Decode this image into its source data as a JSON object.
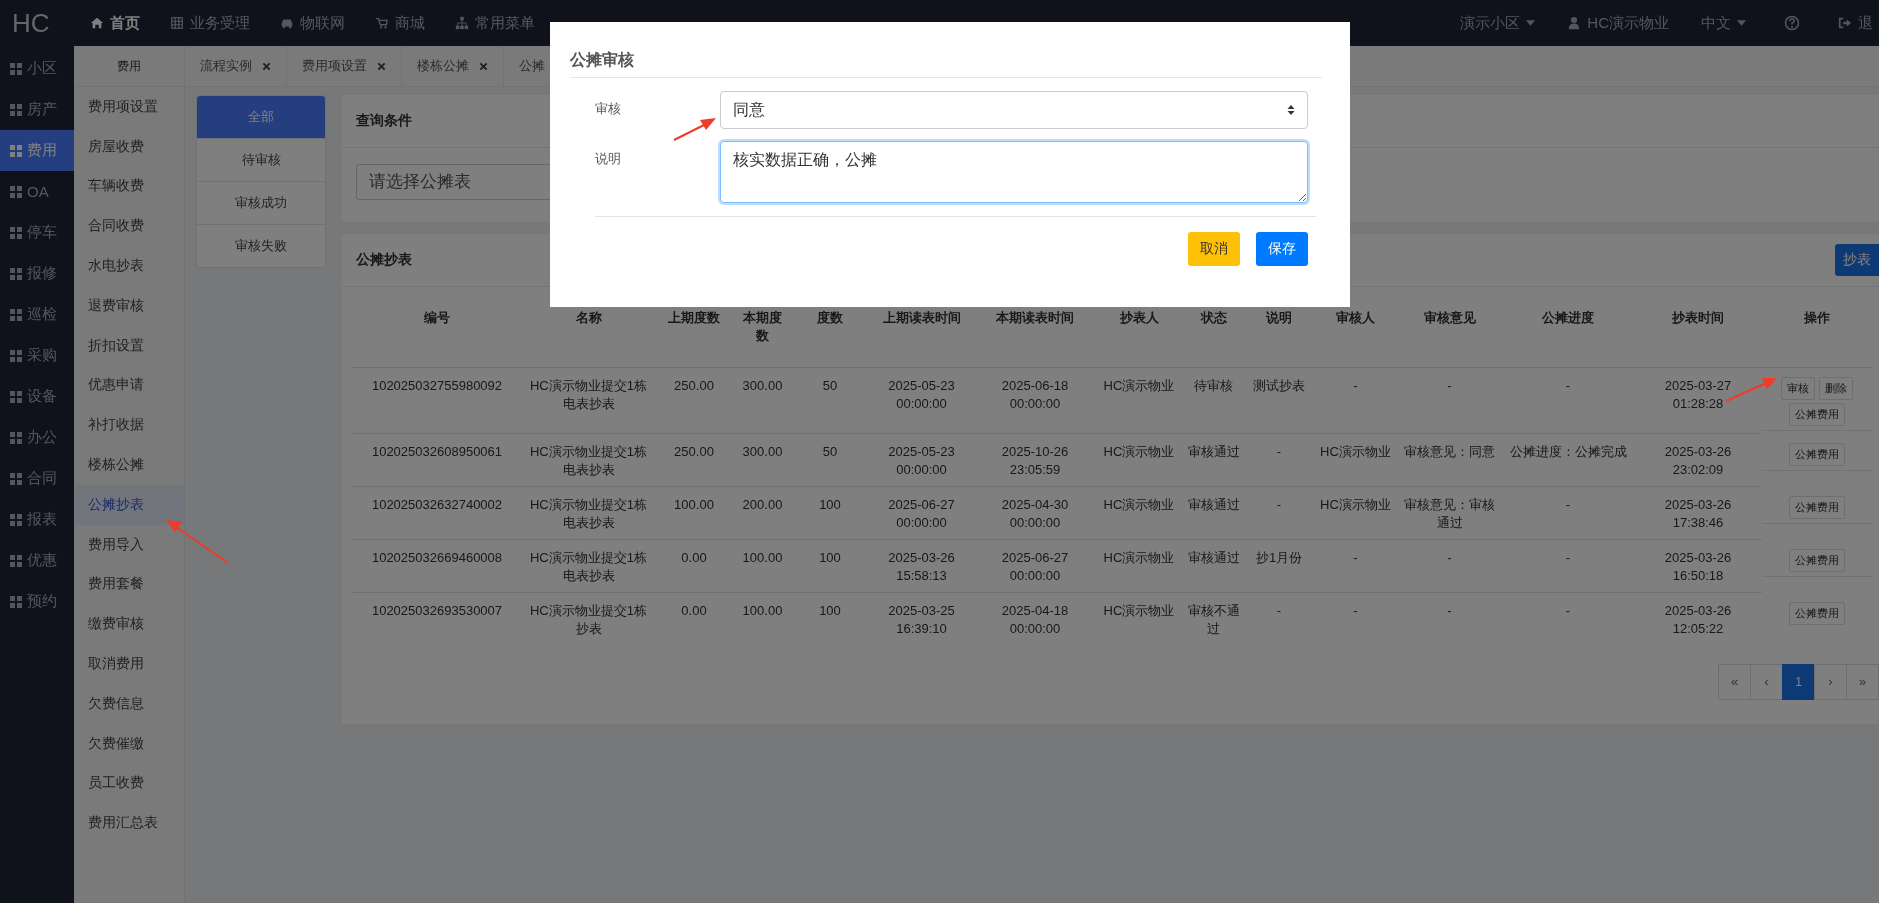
{
  "top_nav": {
    "logo": "HC",
    "items": [
      {
        "label": "首页",
        "selected": true
      },
      {
        "label": "业务受理",
        "selected": false
      },
      {
        "label": "物联网",
        "selected": false
      },
      {
        "label": "商城",
        "selected": false
      },
      {
        "label": "常用菜单",
        "selected": false
      }
    ],
    "community": "演示小区",
    "user": "HC演示物业",
    "language": "中文",
    "logout": "退"
  },
  "sidebar": {
    "items": [
      {
        "label": "小区",
        "selected": false
      },
      {
        "label": "房产",
        "selected": false
      },
      {
        "label": "费用",
        "selected": true
      },
      {
        "label": "OA",
        "selected": false
      },
      {
        "label": "停车",
        "selected": false
      },
      {
        "label": "报修",
        "selected": false
      },
      {
        "label": "巡检",
        "selected": false
      },
      {
        "label": "采购",
        "selected": false
      },
      {
        "label": "设备",
        "selected": false
      },
      {
        "label": "办公",
        "selected": false
      },
      {
        "label": "合同",
        "selected": false
      },
      {
        "label": "报表",
        "selected": false
      },
      {
        "label": "优惠",
        "selected": false
      },
      {
        "label": "预约",
        "selected": false
      }
    ]
  },
  "sub_sidebar": {
    "title": "费用",
    "items": [
      {
        "label": "费用项设置",
        "selected": false
      },
      {
        "label": "房屋收费",
        "selected": false
      },
      {
        "label": "车辆收费",
        "selected": false
      },
      {
        "label": "合同收费",
        "selected": false
      },
      {
        "label": "水电抄表",
        "selected": false
      },
      {
        "label": "退费审核",
        "selected": false
      },
      {
        "label": "折扣设置",
        "selected": false
      },
      {
        "label": "优惠申请",
        "selected": false
      },
      {
        "label": "补打收据",
        "selected": false
      },
      {
        "label": "楼栋公摊",
        "selected": false
      },
      {
        "label": "公摊抄表",
        "selected": true
      },
      {
        "label": "费用导入",
        "selected": false
      },
      {
        "label": "费用套餐",
        "selected": false
      },
      {
        "label": "缴费审核",
        "selected": false
      },
      {
        "label": "取消费用",
        "selected": false
      },
      {
        "label": "欠费信息",
        "selected": false
      },
      {
        "label": "欠费催缴",
        "selected": false
      },
      {
        "label": "员工收费",
        "selected": false
      },
      {
        "label": "费用汇总表",
        "selected": false
      }
    ]
  },
  "tabs": [
    {
      "label": "流程实例",
      "closable": true
    },
    {
      "label": "费用项设置",
      "closable": true
    },
    {
      "label": "楼栋公摊",
      "closable": true
    },
    {
      "label": "公摊",
      "closable": false
    }
  ],
  "filter_tabs": [
    {
      "label": "全部",
      "selected": true
    },
    {
      "label": "待审核",
      "selected": false
    },
    {
      "label": "审核成功",
      "selected": false
    },
    {
      "label": "审核失败",
      "selected": false
    }
  ],
  "query": {
    "title": "查询条件",
    "select": {
      "placeholder": "请选择公摊表"
    }
  },
  "table_panel": {
    "title": "公摊抄表",
    "add_button": "抄表",
    "columns": [
      "编号",
      "名称",
      "上期度数",
      "本期度数",
      "度数",
      "上期读表时间",
      "本期读表时间",
      "抄表人",
      "状态",
      "说明",
      "审核人",
      "审核意见",
      "公摊进度",
      "抄表时间",
      "操作"
    ],
    "rows": [
      {
        "cells": [
          "102025032755980092",
          "HC演示物业提交1栋电表抄表",
          "250.00",
          "300.00",
          "50",
          "2025-05-23 00:00:00",
          "2025-06-18 00:00:00",
          "HC演示物业",
          "待审核",
          "测试抄表",
          "-",
          "-",
          "-",
          "2025-03-27 01:28:28"
        ],
        "actions": [
          "审核",
          "删除",
          "公摊费用"
        ]
      },
      {
        "cells": [
          "102025032608950061",
          "HC演示物业提交1栋电表抄表",
          "250.00",
          "300.00",
          "50",
          "2025-05-23 00:00:00",
          "2025-10-26 23:05:59",
          "HC演示物业",
          "审核通过",
          "-",
          "HC演示物业",
          "审核意见：同意",
          "公摊进度：公摊完成",
          "2025-03-26 23:02:09"
        ],
        "actions": [
          "公摊费用"
        ]
      },
      {
        "cells": [
          "102025032632740002",
          "HC演示物业提交1栋电表抄表",
          "100.00",
          "200.00",
          "100",
          "2025-06-27 00:00:00",
          "2025-04-30 00:00:00",
          "HC演示物业",
          "审核通过",
          "-",
          "HC演示物业",
          "审核意见：审核通过",
          "-",
          "2025-03-26 17:38:46"
        ],
        "actions": [
          "公摊费用"
        ]
      },
      {
        "cells": [
          "102025032669460008",
          "HC演示物业提交1栋电表抄表",
          "0.00",
          "100.00",
          "100",
          "2025-03-26 15:58:13",
          "2025-06-27 00:00:00",
          "HC演示物业",
          "审核通过",
          "抄1月份",
          "-",
          "-",
          "-",
          "2025-03-26 16:50:18"
        ],
        "actions": [
          "公摊费用"
        ]
      },
      {
        "cells": [
          "102025032693530007",
          "HC演示物业提交1栋抄表",
          "0.00",
          "100.00",
          "100",
          "2025-03-25 16:39:10",
          "2025-04-18 00:00:00",
          "HC演示物业",
          "审核不通过",
          "-",
          "-",
          "-",
          "-",
          "2025-03-26 12:05:22"
        ],
        "actions": [
          "公摊费用"
        ]
      }
    ],
    "pagination": [
      {
        "label": "«",
        "selected": false
      },
      {
        "label": "‹",
        "selected": false
      },
      {
        "label": "1",
        "selected": true
      },
      {
        "label": "›",
        "selected": false
      },
      {
        "label": "»",
        "selected": false
      }
    ]
  },
  "modal": {
    "title": "公摊审核",
    "fields": [
      {
        "kind": "select",
        "label": "审核",
        "value": "同意"
      },
      {
        "kind": "textarea",
        "label": "说明",
        "value": "核实数据正确，公摊"
      }
    ],
    "buttons": [
      {
        "label": "取消",
        "kind": "cancel"
      },
      {
        "label": "保存",
        "kind": "primary"
      }
    ]
  }
}
